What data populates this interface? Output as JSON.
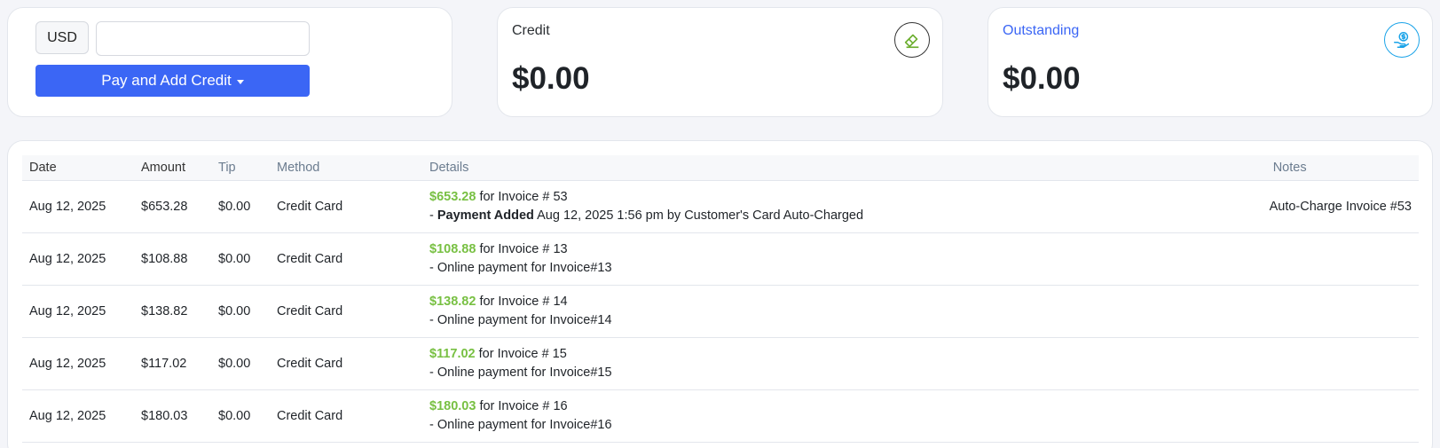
{
  "payment": {
    "currency": "USD",
    "amount_value": "",
    "button_label": "Pay and Add Credit"
  },
  "credit": {
    "label": "Credit",
    "value": "$0.00",
    "icon": "eraser-icon"
  },
  "outstanding": {
    "label": "Outstanding",
    "value": "$0.00",
    "icon": "hand-dollar-icon"
  },
  "table": {
    "headers": {
      "date": "Date",
      "amount": "Amount",
      "tip": "Tip",
      "method": "Method",
      "details": "Details",
      "notes": "Notes"
    },
    "rows": [
      {
        "date": "Aug 12, 2025",
        "amount": "$653.28",
        "tip": "$0.00",
        "method": "Credit Card",
        "detail_amount": "$653.28",
        "detail_invoice": " for Invoice # 53",
        "detail_prefix": "- ",
        "detail_bold": "Payment Added",
        "detail_rest": " Aug 12, 2025 1:56 pm by Customer's Card Auto-Charged",
        "notes": "Auto-Charge Invoice #53"
      },
      {
        "date": "Aug 12, 2025",
        "amount": "$108.88",
        "tip": "$0.00",
        "method": "Credit Card",
        "detail_amount": "$108.88",
        "detail_invoice": " for Invoice # 13",
        "detail_prefix": "",
        "detail_bold": "",
        "detail_rest": "- Online payment for Invoice#13",
        "notes": ""
      },
      {
        "date": "Aug 12, 2025",
        "amount": "$138.82",
        "tip": "$0.00",
        "method": "Credit Card",
        "detail_amount": "$138.82",
        "detail_invoice": " for Invoice # 14",
        "detail_prefix": "",
        "detail_bold": "",
        "detail_rest": "- Online payment for Invoice#14",
        "notes": ""
      },
      {
        "date": "Aug 12, 2025",
        "amount": "$117.02",
        "tip": "$0.00",
        "method": "Credit Card",
        "detail_amount": "$117.02",
        "detail_invoice": " for Invoice # 15",
        "detail_prefix": "",
        "detail_bold": "",
        "detail_rest": "- Online payment for Invoice#15",
        "notes": ""
      },
      {
        "date": "Aug 12, 2025",
        "amount": "$180.03",
        "tip": "$0.00",
        "method": "Credit Card",
        "detail_amount": "$180.03",
        "detail_invoice": " for Invoice # 16",
        "detail_prefix": "",
        "detail_bold": "",
        "detail_rest": "- Online payment for Invoice#16",
        "notes": ""
      }
    ]
  },
  "colors": {
    "accent": "#3b66f5",
    "amount_green": "#78c043",
    "outstanding_icon": "#1aa3e8"
  }
}
